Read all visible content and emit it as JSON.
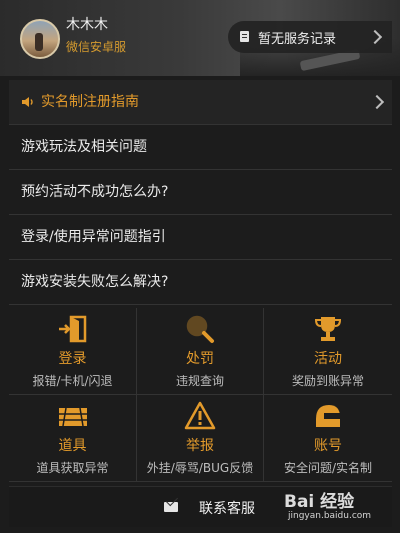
{
  "header": {
    "username": "木木木",
    "subtitle": "微信安卓服",
    "service_button": {
      "icon": "document-icon",
      "label": "暂无服务记录"
    }
  },
  "guide": {
    "icon": "speaker-icon",
    "label": "实名制注册指南"
  },
  "faq": [
    {
      "label": "游戏玩法及相关问题"
    },
    {
      "label": "预约活动不成功怎么办?"
    },
    {
      "label": "登录/使用异常问题指引"
    },
    {
      "label": "游戏安装失败怎么解决?"
    }
  ],
  "grid": [
    {
      "icon": "door-exit-icon",
      "title": "登录",
      "desc": "报错/卡机/闪退"
    },
    {
      "icon": "magnifier-icon",
      "title": "处罚",
      "desc": "违规查询"
    },
    {
      "icon": "trophy-icon",
      "title": "活动",
      "desc": "奖励到账异常"
    },
    {
      "icon": "crate-icon",
      "title": "道具",
      "desc": "道具获取异常"
    },
    {
      "icon": "warning-icon",
      "title": "举报",
      "desc": "外挂/辱骂/BUG反馈"
    },
    {
      "icon": "helmet-icon",
      "title": "账号",
      "desc": "安全问题/实名制"
    }
  ],
  "contact": {
    "icon": "mail-icon",
    "label": "联系客服"
  },
  "watermark": {
    "text": "Bai 经验",
    "url": "jingyan.baidu.com"
  },
  "colors": {
    "accent": "#e29a2b",
    "background": "#1c1c1c"
  }
}
